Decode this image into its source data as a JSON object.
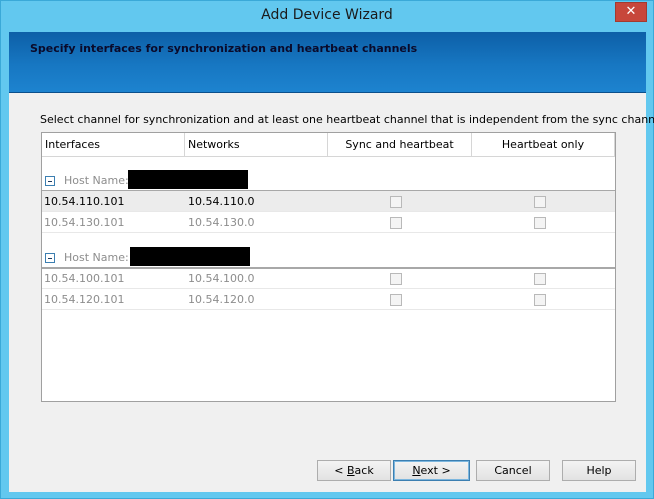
{
  "window": {
    "title": "Add Device Wizard",
    "close_glyph": "✕"
  },
  "banner": {
    "text": "Specify interfaces for synchronization and heartbeat channels"
  },
  "instruction": "Select channel for synchronization and at least one heartbeat channel that is independent from the sync channel.",
  "grid": {
    "columns": [
      "Interfaces",
      "Networks",
      "Sync and heartbeat",
      "Heartbeat only"
    ],
    "groups": [
      {
        "host_label": "Host Name:",
        "rows": [
          {
            "interface": "10.54.110.101",
            "network": "10.54.110.0",
            "sync": false,
            "heartbeat": false,
            "selected": true
          },
          {
            "interface": "10.54.130.101",
            "network": "10.54.130.0",
            "sync": false,
            "heartbeat": false,
            "selected": false
          }
        ]
      },
      {
        "host_label": "Host Name:",
        "rows": [
          {
            "interface": "10.54.100.101",
            "network": "10.54.100.0",
            "sync": false,
            "heartbeat": false,
            "selected": false
          },
          {
            "interface": "10.54.120.101",
            "network": "10.54.120.0",
            "sync": false,
            "heartbeat": false,
            "selected": false
          }
        ]
      }
    ]
  },
  "buttons": {
    "back_prefix": "< ",
    "back_key": "B",
    "back_rest": "ack",
    "next_key": "N",
    "next_rest": "ext >",
    "cancel": "Cancel",
    "help": "Help"
  }
}
